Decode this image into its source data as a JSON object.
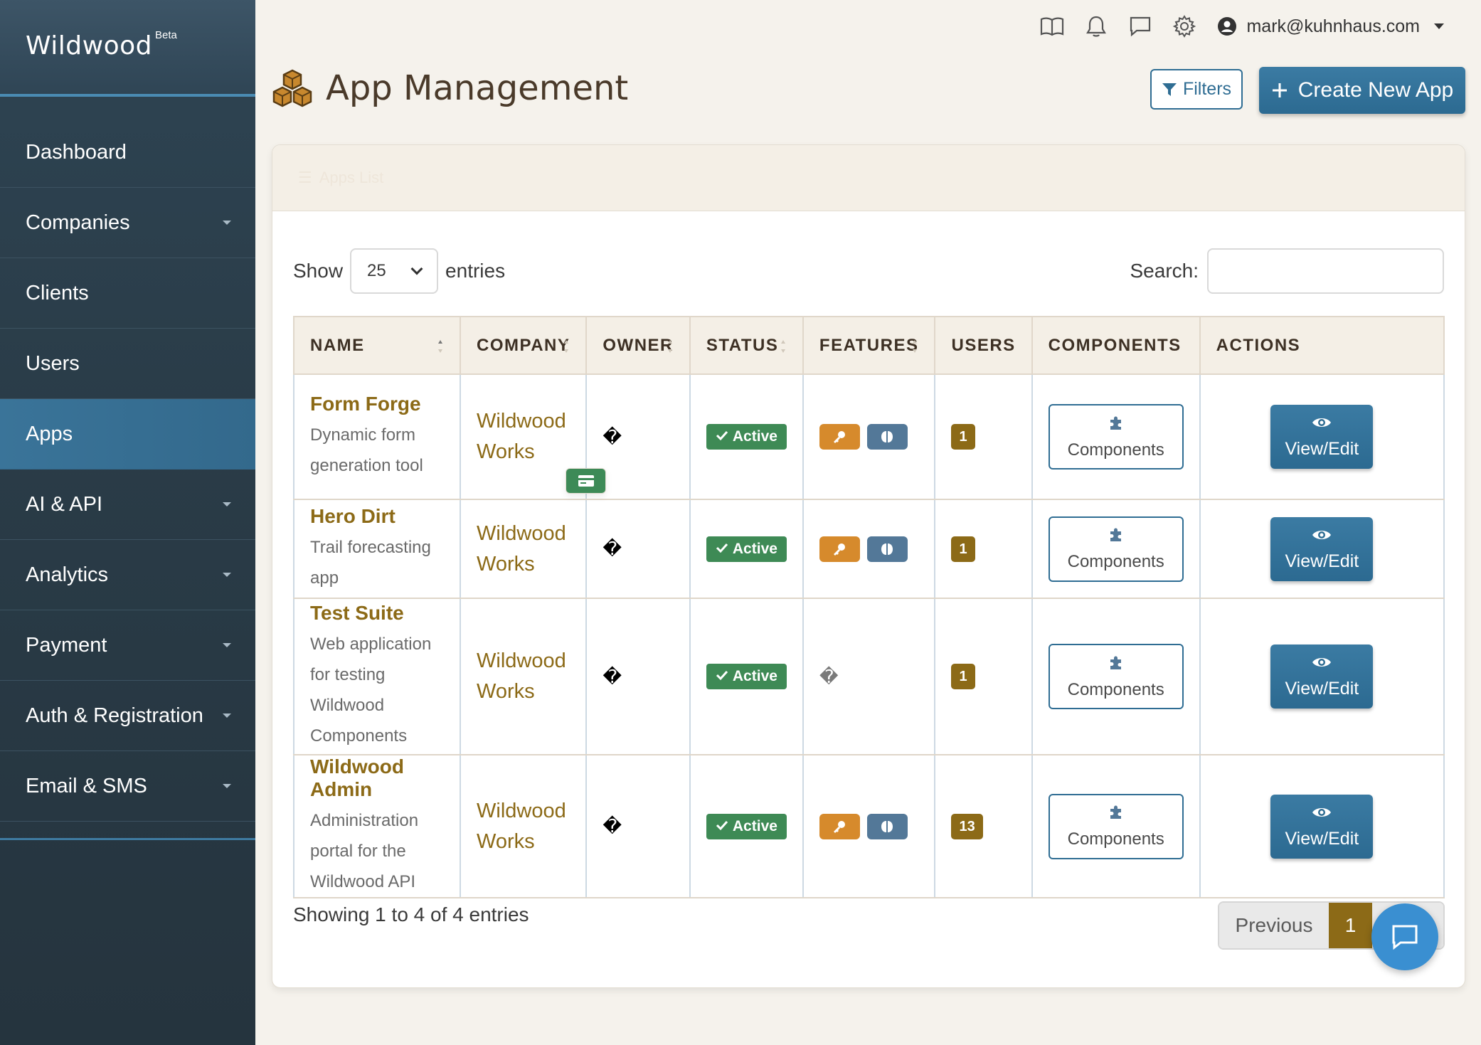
{
  "brand": {
    "name": "Wildwood",
    "sup": "Beta"
  },
  "sidebar": {
    "items": [
      {
        "label": "Dashboard",
        "has_caret": false,
        "active": false
      },
      {
        "label": "Companies",
        "has_caret": true,
        "active": false
      },
      {
        "label": "Clients",
        "has_caret": false,
        "active": false
      },
      {
        "label": "Users",
        "has_caret": false,
        "active": false
      },
      {
        "label": "Apps",
        "has_caret": false,
        "active": true
      },
      {
        "label": "AI & API",
        "has_caret": true,
        "active": false
      },
      {
        "label": "Analytics",
        "has_caret": true,
        "active": false
      },
      {
        "label": "Payment",
        "has_caret": true,
        "active": false
      },
      {
        "label": "Auth & Registration",
        "has_caret": true,
        "active": false
      },
      {
        "label": "Email & SMS",
        "has_caret": true,
        "active": false
      }
    ]
  },
  "topbar": {
    "icons": [
      "book-icon",
      "bell-icon",
      "chat-bubble-icon",
      "gear-icon"
    ],
    "user_email": "mark@kuhnhaus.com"
  },
  "header": {
    "title": "App Management",
    "filters_label": "Filters",
    "create_label": "Create New App"
  },
  "card": {
    "header_text": "Apps List"
  },
  "table_controls": {
    "show_label": "Show",
    "page_length": "25",
    "entries_label": "entries",
    "search_label": "Search:",
    "search_value": ""
  },
  "table": {
    "columns": [
      "NAME",
      "COMPANY",
      "OWNER",
      "STATUS",
      "FEATURES",
      "USERS",
      "COMPONENTS",
      "ACTIONS"
    ],
    "rows": [
      {
        "name": "Form Forge",
        "desc": "Dynamic form generation tool",
        "company": "Wildwood Works",
        "owner": "�",
        "status": "Active",
        "features": [
          "key",
          "brain"
        ],
        "users": "1",
        "components": "Components",
        "action": "View/Edit"
      },
      {
        "name": "Hero Dirt",
        "desc": "Trail forecasting app",
        "company": "Wildwood Works",
        "owner": "�",
        "status": "Active",
        "features": [
          "key",
          "brain"
        ],
        "users": "1",
        "components": "Components",
        "action": "View/Edit"
      },
      {
        "name": "Test Suite",
        "desc": "Web application for testing Wildwood Components",
        "company": "Wildwood Works",
        "owner": "�",
        "status": "Active",
        "features": [],
        "features_unknown": "�",
        "users": "1",
        "components": "Components",
        "action": "View/Edit"
      },
      {
        "name": "Wildwood Admin",
        "desc": "Administration portal for the Wildwood API",
        "company": "Wildwood Works",
        "owner": "�",
        "status": "Active",
        "features": [
          "key",
          "brain",
          "card"
        ],
        "users": "13",
        "components": "Components",
        "action": "View/Edit"
      }
    ]
  },
  "footer": {
    "info": "Showing 1 to 4 of 4 entries",
    "prev_label": "Previous",
    "current_page": "1"
  },
  "colors": {
    "sidebar_bg": "#2a3c48",
    "accent_blue": "#2f6d93",
    "gold": "#8c6a17",
    "active_green": "#3e8a55",
    "key_orange": "#d68a2c",
    "brain_slate": "#537898",
    "chat_blue": "#3a8fd1"
  }
}
